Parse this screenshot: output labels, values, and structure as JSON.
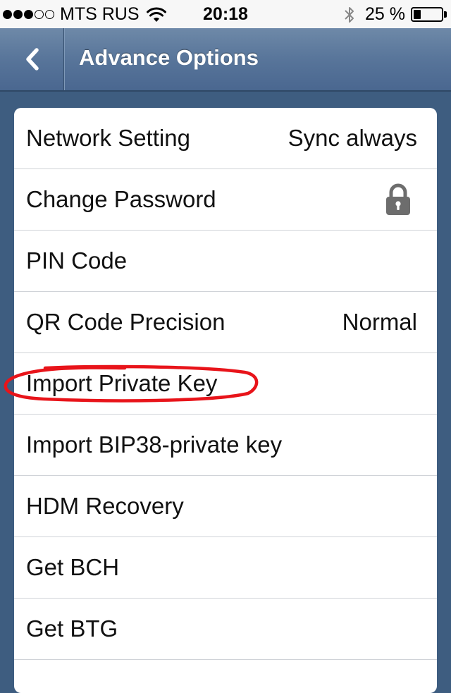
{
  "status_bar": {
    "signal_dots_filled": 3,
    "signal_dots_total": 5,
    "carrier": "MTS RUS",
    "time": "20:18",
    "battery_percent": "25 %",
    "battery_level": 0.25
  },
  "nav": {
    "back_icon": "chevron-left-icon",
    "title": "Advance Options"
  },
  "settings": [
    {
      "label": "Network Setting",
      "value": "Sync always"
    },
    {
      "label": "Change Password",
      "icon": "lock-icon"
    },
    {
      "label": "PIN Code"
    },
    {
      "label": "QR Code Precision",
      "value": "Normal"
    },
    {
      "label": "Import Private Key",
      "highlighted": true
    },
    {
      "label": "Import BIP38-private key"
    },
    {
      "label": "HDM Recovery"
    },
    {
      "label": "Get BCH"
    },
    {
      "label": "Get BTG"
    }
  ],
  "colors": {
    "background": "#3e5d80",
    "nav_bar": "#58759a",
    "annotation": "#e8141a"
  }
}
